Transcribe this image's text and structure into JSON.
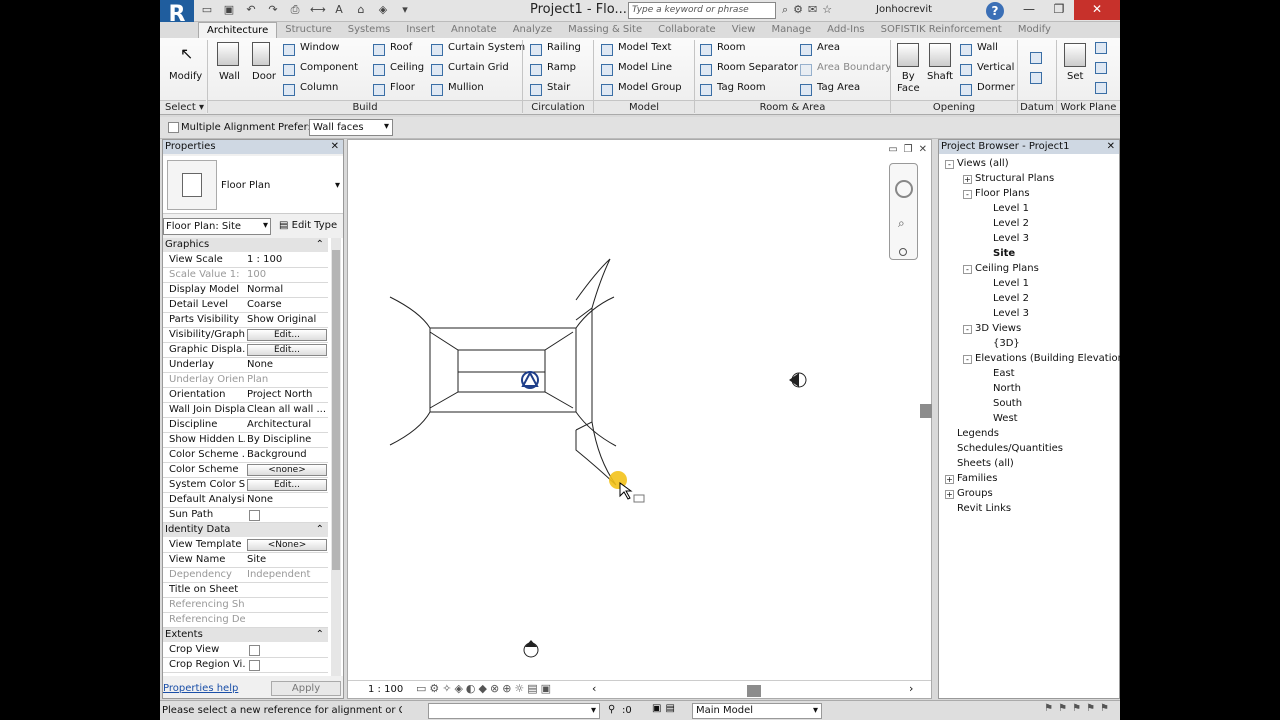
{
  "title_bar": {
    "app_logo": "R",
    "document_title": "Project1 - Flo...",
    "search_placeholder": "Type a keyword or phrase",
    "user": "Jonhocrevit",
    "help": "?"
  },
  "ribbon_tabs": [
    "Architecture",
    "Structure",
    "Systems",
    "Insert",
    "Annotate",
    "Analyze",
    "Massing & Site",
    "Collaborate",
    "View",
    "Manage",
    "Add-Ins",
    "SOFISTIK Reinforcement",
    "Modify"
  ],
  "active_tab": "Architecture",
  "ribbon": {
    "select": {
      "modify": "Modify",
      "panel": "Select"
    },
    "build": {
      "wall": "Wall",
      "door": "Door",
      "window": "Window",
      "component": "Component",
      "column": "Column",
      "roof": "Roof",
      "ceiling": "Ceiling",
      "floor": "Floor",
      "curtain_system": "Curtain System",
      "curtain_grid": "Curtain Grid",
      "mullion": "Mullion",
      "panel": "Build"
    },
    "circulation": {
      "railing": "Railing",
      "ramp": "Ramp",
      "stair": "Stair",
      "panel": "Circulation"
    },
    "model": {
      "text": "Model Text",
      "line": "Model Line",
      "group": "Model Group",
      "panel": "Model"
    },
    "room_area": {
      "room": "Room",
      "separator": "Room Separator",
      "tag_room": "Tag Room",
      "area": "Area",
      "area_boundary": "Area Boundary",
      "tag_area": "Tag Area",
      "panel": "Room & Area"
    },
    "opening": {
      "by_face": "By\nFace",
      "shaft": "Shaft",
      "wall": "Wall",
      "vertical": "Vertical",
      "dormer": "Dormer",
      "panel": "Opening"
    },
    "datum": {
      "panel": "Datum"
    },
    "work_plane": {
      "set": "Set",
      "panel": "Work Plane"
    }
  },
  "options_bar": {
    "multiple_alignment": "Multiple Alignment",
    "prefer_label": "Prefer:",
    "prefer_value": "Wall faces"
  },
  "properties": {
    "title": "Properties",
    "type_name": "Floor Plan",
    "selector": "Floor Plan: Site",
    "edit_type": "Edit Type",
    "groups": [
      {
        "name": "Graphics",
        "rows": [
          {
            "k": "View Scale",
            "v": "1 : 100"
          },
          {
            "k": "Scale Value    1:",
            "v": "100",
            "gray": true
          },
          {
            "k": "Display Model",
            "v": "Normal"
          },
          {
            "k": "Detail Level",
            "v": "Coarse"
          },
          {
            "k": "Parts Visibility",
            "v": "Show Original"
          },
          {
            "k": "Visibility/Graph...",
            "btn": "Edit..."
          },
          {
            "k": "Graphic Displa...",
            "btn": "Edit..."
          },
          {
            "k": "Underlay",
            "v": "None"
          },
          {
            "k": "Underlay Orien...",
            "v": "Plan",
            "gray": true
          },
          {
            "k": "Orientation",
            "v": "Project North"
          },
          {
            "k": "Wall Join Display",
            "v": "Clean all wall ..."
          },
          {
            "k": "Discipline",
            "v": "Architectural"
          },
          {
            "k": "Show Hidden L...",
            "v": "By Discipline"
          },
          {
            "k": "Color Scheme ...",
            "v": "Background"
          },
          {
            "k": "Color Scheme",
            "btn": "<none>"
          },
          {
            "k": "System Color S...",
            "btn": "Edit..."
          },
          {
            "k": "Default Analysi...",
            "v": "None"
          },
          {
            "k": "Sun Path",
            "check": true
          }
        ]
      },
      {
        "name": "Identity Data",
        "rows": [
          {
            "k": "View Template",
            "btn": "<None>"
          },
          {
            "k": "View Name",
            "v": "Site"
          },
          {
            "k": "Dependency",
            "v": "Independent",
            "gray": true
          },
          {
            "k": "Title on Sheet",
            "v": ""
          },
          {
            "k": "Referencing Sh...",
            "v": "",
            "gray": true
          },
          {
            "k": "Referencing De...",
            "v": "",
            "gray": true
          }
        ]
      },
      {
        "name": "Extents",
        "rows": [
          {
            "k": "Crop View",
            "check": true
          },
          {
            "k": "Crop Region Vi...",
            "check": true
          }
        ]
      }
    ],
    "help_link": "Properties help",
    "apply": "Apply"
  },
  "project_browser": {
    "title": "Project Browser - Project1",
    "nodes": [
      {
        "label": "Views (all)",
        "level": 0,
        "toggle": "-"
      },
      {
        "label": "Structural Plans",
        "level": 1,
        "toggle": "+"
      },
      {
        "label": "Floor Plans",
        "level": 1,
        "toggle": "-"
      },
      {
        "label": "Level 1",
        "level": 2
      },
      {
        "label": "Level 2",
        "level": 2
      },
      {
        "label": "Level 3",
        "level": 2
      },
      {
        "label": "Site",
        "level": 2,
        "bold": true
      },
      {
        "label": "Ceiling Plans",
        "level": 1,
        "toggle": "-"
      },
      {
        "label": "Level 1",
        "level": 2
      },
      {
        "label": "Level 2",
        "level": 2
      },
      {
        "label": "Level 3",
        "level": 2
      },
      {
        "label": "3D Views",
        "level": 1,
        "toggle": "-"
      },
      {
        "label": "{3D}",
        "level": 2
      },
      {
        "label": "Elevations (Building Elevation)",
        "level": 1,
        "toggle": "-"
      },
      {
        "label": "East",
        "level": 2
      },
      {
        "label": "North",
        "level": 2
      },
      {
        "label": "South",
        "level": 2
      },
      {
        "label": "West",
        "level": 2
      },
      {
        "label": "Legends",
        "level": 0
      },
      {
        "label": "Schedules/Quantities",
        "level": 0
      },
      {
        "label": "Sheets (all)",
        "level": 0
      },
      {
        "label": "Families",
        "level": 0,
        "toggle": "+"
      },
      {
        "label": "Groups",
        "level": 0,
        "toggle": "+"
      },
      {
        "label": "Revit Links",
        "level": 0
      }
    ]
  },
  "view_control_bar": {
    "scale": "1 : 100"
  },
  "status_bar": {
    "message": "Please select a new reference for alignment or Ctrl-click",
    "selection_count": ":0",
    "model": "Main Model"
  }
}
